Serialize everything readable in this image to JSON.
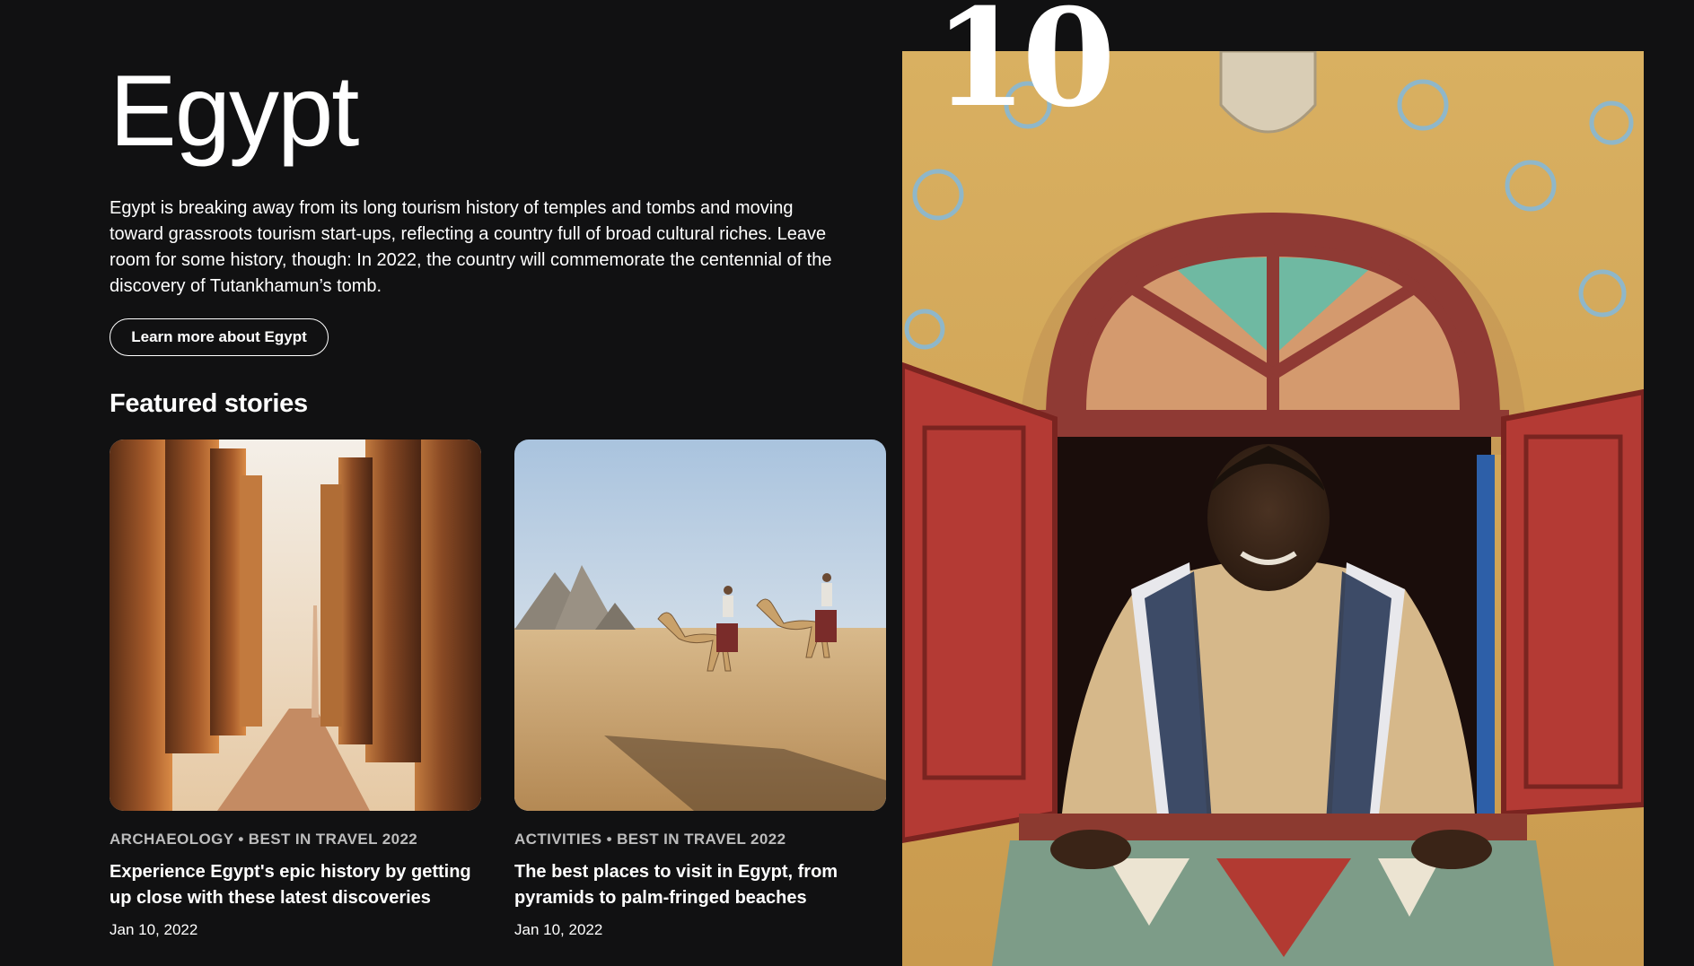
{
  "destination": {
    "title": "Egypt",
    "rank": "10",
    "description": "Egypt is breaking away from its long tourism history of temples and tombs and moving toward grassroots tourism start-ups, reflecting a country full of broad cultural riches. Leave room for some history, though: In 2022, the country will commemorate the centennial of the discovery of Tutankhamun’s tomb.",
    "learn_more_label": "Learn more about Egypt"
  },
  "featured": {
    "heading": "Featured stories",
    "stories": [
      {
        "meta": "ARCHAEOLOGY • BEST IN TRAVEL 2022",
        "headline": "Experience Egypt's epic history by getting up close with these latest discoveries",
        "date": "Jan 10, 2022"
      },
      {
        "meta": "ACTIVITIES • BEST IN TRAVEL 2022",
        "headline": "The best places to visit in Egypt, from pyramids to palm-fringed beaches",
        "date": "Jan 10, 2022"
      }
    ]
  },
  "colors": {
    "background": "#111112",
    "text": "#ffffff",
    "meta_text": "#bdbdbd"
  }
}
